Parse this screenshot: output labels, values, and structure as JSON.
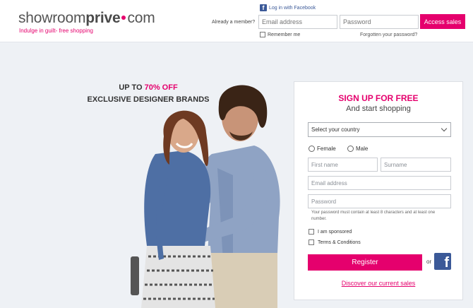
{
  "header": {
    "logo": {
      "part1": "showroom",
      "part2": "prive",
      "part3": "com"
    },
    "tagline": "Indulge in guilt- free shopping",
    "facebook_login": "Log in with Facebook",
    "already_member": "Already a member?",
    "email_placeholder": "Email address",
    "password_placeholder": "Password",
    "access_button": "Access sales",
    "remember_me": "Remember me",
    "forgotten_password": "Forgotten your password?"
  },
  "promo": {
    "prefix": "UP TO ",
    "highlight": "70% OFF",
    "line2": "EXCLUSIVE DESIGNER BRANDS"
  },
  "signup": {
    "title": "SIGN UP FOR FREE",
    "subtitle": "And start shopping",
    "country_select": "Select your country",
    "gender_female": "Female",
    "gender_male": "Male",
    "first_name": "First name",
    "surname": "Surname",
    "email": "Email address",
    "password": "Password",
    "password_hint": "Your password must contain at least 8 characters and at least one number.",
    "sponsored": "I am sponsored",
    "terms": "Terms & Conditions",
    "register_button": "Register",
    "or": "or",
    "discover_link": "Discover our current sales"
  },
  "colors": {
    "brand_pink": "#e5006d",
    "facebook_blue": "#3b5998"
  },
  "icons": {
    "facebook": "facebook-icon",
    "dropdown": "chevron-down-icon"
  }
}
